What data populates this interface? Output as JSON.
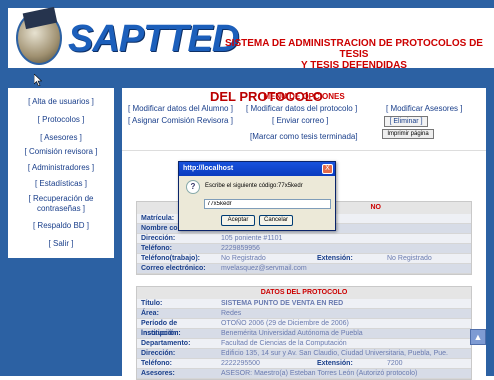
{
  "header": {
    "logo_text": "SAPTTED",
    "title_line1": "SISTEMA DE ADMINISTRACION DE PROTOCOLOS DE TESIS",
    "title_line2": "Y TESIS DEFENDIDAS"
  },
  "sidebar": {
    "items": [
      "[ Alta de usuarios ]",
      "[ Protocolos ]",
      "[ Asesores ]",
      "[ Comisión revisora ]",
      "[ Administradores ]",
      "[ Estadísticas ]",
      "[ Recuperación de contraseñas ]",
      "[ Respaldo BD ]",
      "[ Salir ]"
    ]
  },
  "menu": {
    "title": "MENU DE OPCIONES",
    "mod_alumno": "[ Modificar datos del Alumno ]",
    "mod_protocolo": "[ Modificar datos del protocolo ]",
    "mod_asesores": "[ Modificar Asesores ]",
    "asignar": "[ Asignar Comisión Revisora ]",
    "enviar": "[ Enviar correo ]",
    "eliminar": "[ Eliminar ]",
    "imprimir": "Imprimir página",
    "marcar": "[Marcar como tesis terminada]"
  },
  "section_title": "DEL PROTOCOLO",
  "alumno": {
    "header": "DATOS DEL ALUMNO",
    "header_visible": "NO",
    "rows": [
      {
        "label": "Matrícula:",
        "value": ""
      },
      {
        "label": "Nombre co",
        "value": ""
      },
      {
        "label": "Dirección:",
        "value": "105 poniente #1101"
      },
      {
        "label": "Teléfono:",
        "value": "2229859956"
      },
      {
        "label": "Teléfono(trabajo):",
        "value": "No Registrado",
        "ext_label": "Extensión:",
        "ext_value": "No Registrado"
      },
      {
        "label": "Correo electrónico:",
        "value": "mvelasquez@servmail.com"
      }
    ]
  },
  "protocolo": {
    "header": "DATOS DEL PROTOCOLO",
    "rows": [
      {
        "label": "Título:",
        "value": "SISTEMA PUNTO DE VENTA EN RED"
      },
      {
        "label": "Área:",
        "value": "Redes"
      },
      {
        "label": "Período de inscripción:",
        "value": "OTOÑO 2006 (29 de Diciembre de 2006)"
      },
      {
        "label": "Institución:",
        "value": "Benemérita Universidad Autónoma de Puebla"
      },
      {
        "label": "Departamento:",
        "value": "Facultad de Ciencias de la Computación"
      },
      {
        "label": "Dirección:",
        "value": "Edificio 135, 14 sur y Av. San Claudio, Ciudad Universitaria, Puebla, Pue."
      },
      {
        "label": "Teléfono:",
        "value": "2222295500",
        "ext_label": "Extensión:",
        "ext_value": "7200"
      },
      {
        "label": "Asesores:",
        "value": "ASESOR: Maestro(a) Esteban Torres León (Autorizó protocolo)"
      }
    ]
  },
  "dialog": {
    "title": "http://localhost",
    "close": "X",
    "icon": "?",
    "message": "Escribe el siguiente código:77x5kedr",
    "input_value": "77x5kedr",
    "accept": "Aceptar",
    "cancel": "Cancelar"
  },
  "scroll_button": "▲"
}
